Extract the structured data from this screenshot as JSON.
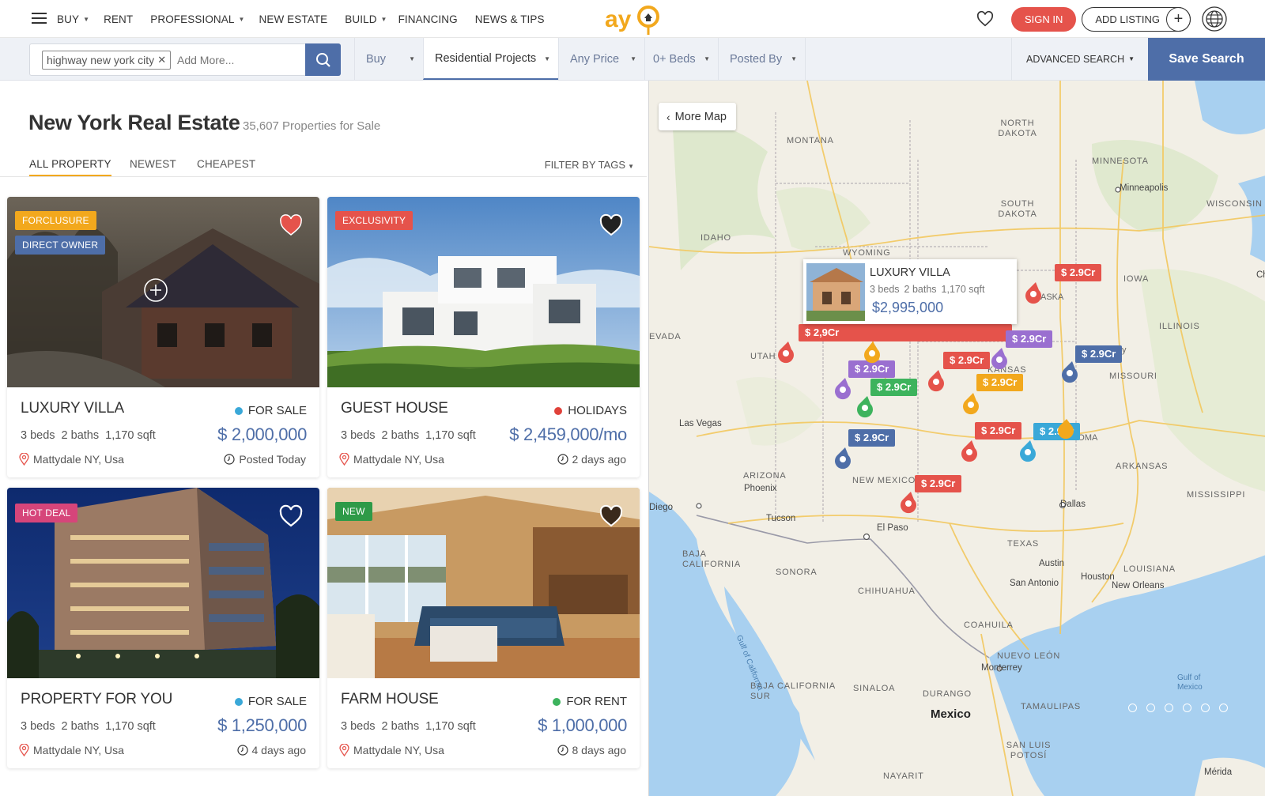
{
  "header": {
    "nav": [
      {
        "label": "BUY",
        "dropdown": true
      },
      {
        "label": "RENT",
        "dropdown": false
      },
      {
        "label": "PROFESSIONAL",
        "dropdown": true
      },
      {
        "label": "NEW ESTATE",
        "dropdown": false
      },
      {
        "label": "BUILD",
        "dropdown": true
      },
      {
        "label": "FINANCING",
        "dropdown": false
      },
      {
        "label": "NEWS & TIPS",
        "dropdown": false
      }
    ],
    "sign_in": "SIGN IN",
    "add_listing": "ADD LISTING"
  },
  "search": {
    "chip": "highway new york city",
    "placeholder": "Add More...",
    "filters": {
      "buy": "Buy",
      "project": "Residential Projects",
      "price": "Any Price",
      "beds": "0+ Beds",
      "posted": "Posted By"
    },
    "advanced": "ADVANCED SEARCH",
    "save": "Save Search"
  },
  "listing": {
    "title": "New York Real Estate",
    "count": "35,607 Properties for Sale",
    "tabs": [
      "ALL PROPERTY",
      "NEWEST",
      "CHEAPEST"
    ],
    "filter_tags": "FILTER BY TAGS"
  },
  "cards": [
    {
      "badge": "FORCLUSURE",
      "badge2": "DIRECT OWNER",
      "title": "LUXURY VILLA",
      "status": "FOR SALE",
      "status_color": "#3aa8d8",
      "beds": "3 beds",
      "baths": "2 baths",
      "sqft": "1,170 sqft",
      "price": "$ 2,000,000",
      "location": "Mattydale NY, Usa",
      "time": "Posted Today",
      "favorited": true
    },
    {
      "badge": "EXCLUSIVITY",
      "title": "GUEST HOUSE",
      "status": "HOLIDAYS",
      "status_color": "#e0413a",
      "beds": "3 beds",
      "baths": "2 baths",
      "sqft": "1,170 sqft",
      "price": "$ 2,459,000/mo",
      "location": "Mattydale NY, Usa",
      "time": "2 days ago",
      "favorited": true
    },
    {
      "badge": "HOT DEAL",
      "title": "PROPERTY FOR YOU",
      "status": "FOR SALE",
      "status_color": "#3aa8d8",
      "beds": "3 beds",
      "baths": "2 baths",
      "sqft": "1,170 sqft",
      "price": "$ 1,250,000",
      "location": "Mattydale NY, Usa",
      "time": "4 days ago",
      "favorited": false
    },
    {
      "badge": "NEW",
      "title": "FARM HOUSE",
      "status": "FOR RENT",
      "status_color": "#3db35d",
      "beds": "3 beds",
      "baths": "2 baths",
      "sqft": "1,170 sqft",
      "price": "$ 1,000,000",
      "location": "Mattydale NY, Usa",
      "time": "8 days ago",
      "favorited": false
    }
  ],
  "map": {
    "more_map": "More Map",
    "states": [
      "NORTH DAKOTA",
      "MONTANA",
      "MINNESOTA",
      "SOUTH DAKOTA",
      "WISCONSIN",
      "IDAHO",
      "WYOMING",
      "IOWA",
      "ILLINOIS",
      "EVADA",
      "UTAH",
      "KANSAS",
      "MISSOURI",
      "ARIZONA",
      "NEW MEXICO",
      "ARKANSAS",
      "MISSISSIPPI",
      "TEXAS",
      "LOUISIANA",
      "BAJA CALIFORNIA",
      "SONORA",
      "CHIHUAHUA",
      "COAHUILA",
      "NUEVO LEÓN",
      "BAJA CALIFORNIA SUR",
      "SINALOA",
      "DURANGO",
      "TAMAULIPAS",
      "SAN LUIS POTOSÍ",
      "NAYARIT"
    ],
    "cities": [
      "Minneapolis",
      "Las Vegas",
      "Phoenix",
      "Diego",
      "Tucson",
      "El Paso",
      "Dallas",
      "Austin",
      "San Antonio",
      "Houston",
      "New Orleans",
      "Monterrey",
      "Mexico",
      "Mérida",
      "Chica",
      "Gulf of California",
      "Gulf of Mexico",
      "OKLAHOMA",
      "ASKA",
      "ty",
      "r"
    ],
    "popup": {
      "title": "LUXURY VILLA",
      "beds": "3 beds",
      "baths": "2 baths",
      "sqft": "1,170 sqft",
      "price": "$2,995,000"
    },
    "price_tag": "$ 2.9Cr",
    "popup_tag": "$ 2,9Cr"
  }
}
